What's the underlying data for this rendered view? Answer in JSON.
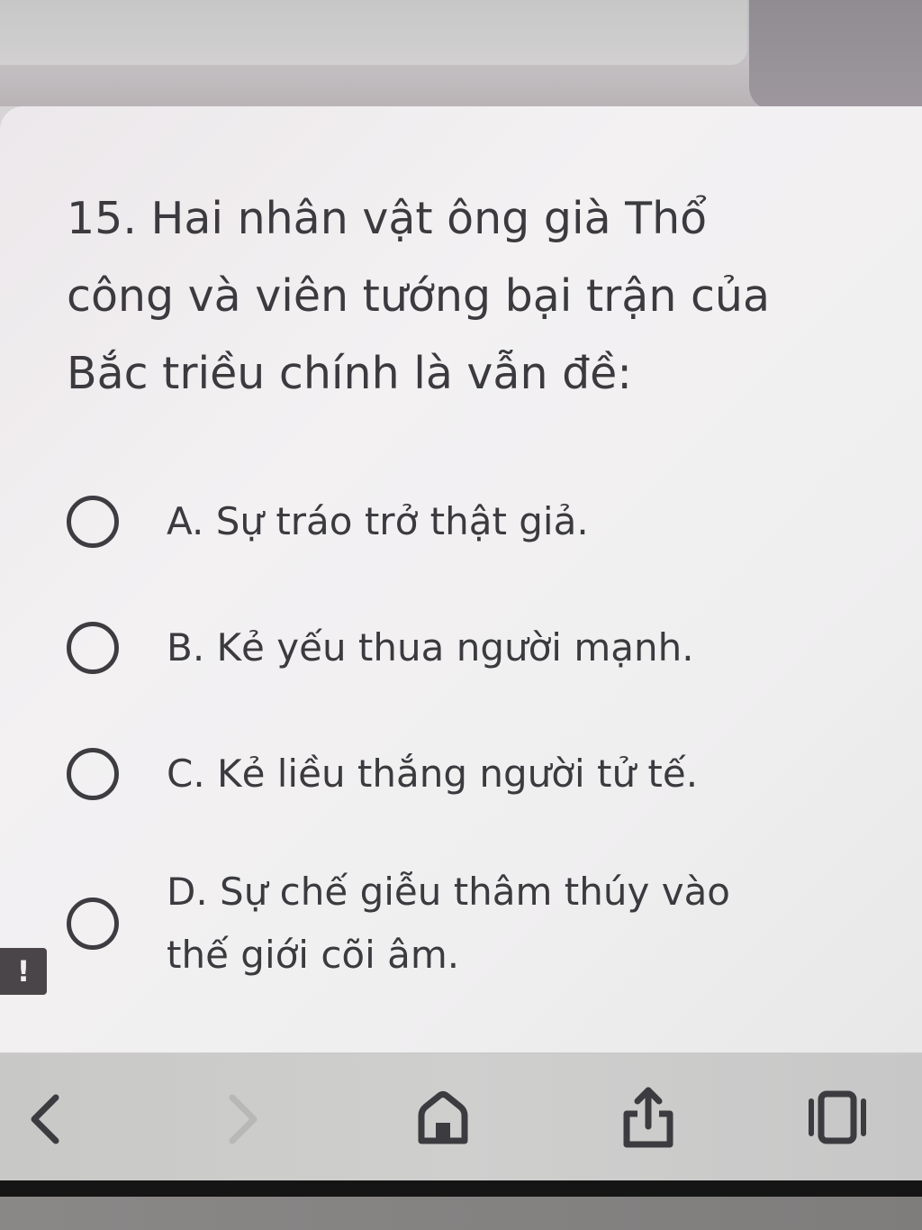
{
  "question": {
    "text": "15. Hai nhân vật ông già Thổ công và viên tướng bại trận của Bắc triều chính là vẫn đề:"
  },
  "options": [
    {
      "label": "A. Sự tráo trở thật giả."
    },
    {
      "label": "B. Kẻ yếu thua người mạnh."
    },
    {
      "label": "C. Kẻ liều thắng người tử tế."
    },
    {
      "label": "D. Sự chế giễu thâm thúy vào thế giới cõi âm."
    }
  ],
  "feedback": {
    "label": "!"
  },
  "browser_nav": {
    "icons": [
      "chevron-left-icon",
      "chevron-right-icon",
      "home-icon",
      "share-icon",
      "tabs-icon"
    ]
  },
  "colors": {
    "text": "#3b3a3e",
    "card": "#f0eef0",
    "nav_icon": "#3c3b3f"
  }
}
